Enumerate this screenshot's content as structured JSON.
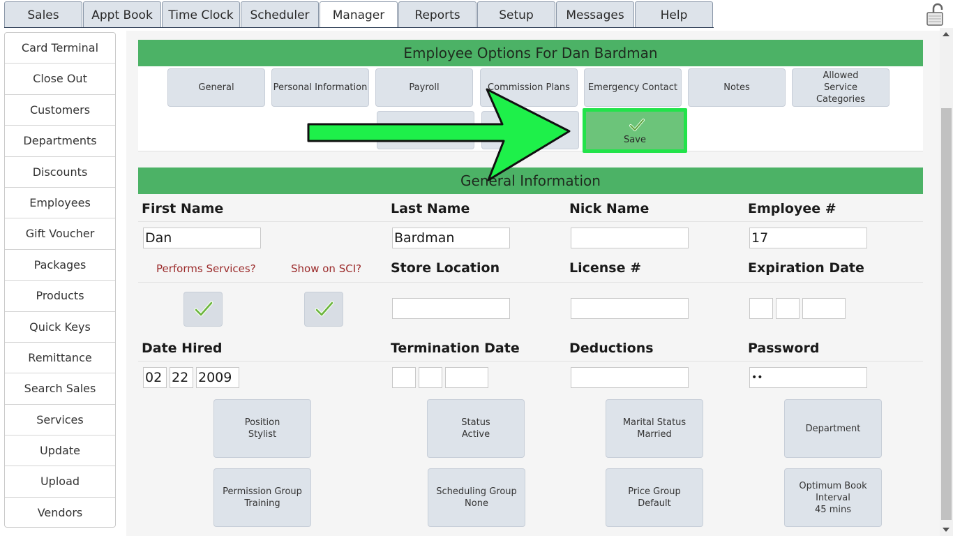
{
  "tabs": [
    {
      "label": "Sales",
      "active": false
    },
    {
      "label": "Appt Book",
      "active": false
    },
    {
      "label": "Time Clock",
      "active": false
    },
    {
      "label": "Scheduler",
      "active": false
    },
    {
      "label": "Manager",
      "active": true
    },
    {
      "label": "Reports",
      "active": false
    },
    {
      "label": "Setup",
      "active": false
    },
    {
      "label": "Messages",
      "active": false
    },
    {
      "label": "Help",
      "active": false
    }
  ],
  "sidebar": {
    "items": [
      "Card Terminal",
      "Close Out",
      "Customers",
      "Departments",
      "Discounts",
      "Employees",
      "Gift Voucher",
      "Packages",
      "Products",
      "Quick Keys",
      "Remittance",
      "Search Sales",
      "Services",
      "Update",
      "Upload",
      "Vendors"
    ]
  },
  "options": {
    "title": "Employee Options For Dan Bardman",
    "buttons": [
      "General",
      "Personal Information",
      "Payroll",
      "Commission Plans",
      "Emergency Contact",
      "Notes",
      "Allowed Service Categories"
    ],
    "save_label": "Save"
  },
  "general": {
    "title": "General Information",
    "first_name_label": "First Name",
    "first_name": "Dan",
    "last_name_label": "Last Name",
    "last_name": "Bardman",
    "nick_name_label": "Nick Name",
    "nick_name": "",
    "employee_no_label": "Employee #",
    "employee_no": "17",
    "performs_services_label": "Performs Services?",
    "show_on_sci_label": "Show on SCI?",
    "store_location_label": "Store Location",
    "store_location": "",
    "license_label": "License #",
    "license": "",
    "expiration_label": "Expiration Date",
    "expiration": {
      "month": "",
      "day": "",
      "year": ""
    },
    "date_hired_label": "Date Hired",
    "date_hired": {
      "month": "02",
      "day": "22",
      "year": "2009"
    },
    "termination_label": "Termination Date",
    "termination": {
      "month": "",
      "day": "",
      "year": ""
    },
    "deductions_label": "Deductions",
    "deductions": "",
    "password_label": "Password",
    "password": "••"
  },
  "field_buttons": {
    "position": {
      "title": "Position",
      "value": "Stylist"
    },
    "status": {
      "title": "Status",
      "value": "Active"
    },
    "marital": {
      "title": "Marital Status",
      "value": "Married"
    },
    "department": {
      "title": "Department",
      "value": ""
    },
    "permission": {
      "title": "Permission Group",
      "value": "Training"
    },
    "scheduling": {
      "title": "Scheduling Group",
      "value": "None"
    },
    "price": {
      "title": "Price Group",
      "value": "Default"
    },
    "optimum": {
      "title": "Optimum Book Interval",
      "value": "45 mins"
    }
  },
  "colors": {
    "header_green": "#4cb266",
    "save_highlight": "#22e34a",
    "arrow_green": "#1ef04a"
  }
}
